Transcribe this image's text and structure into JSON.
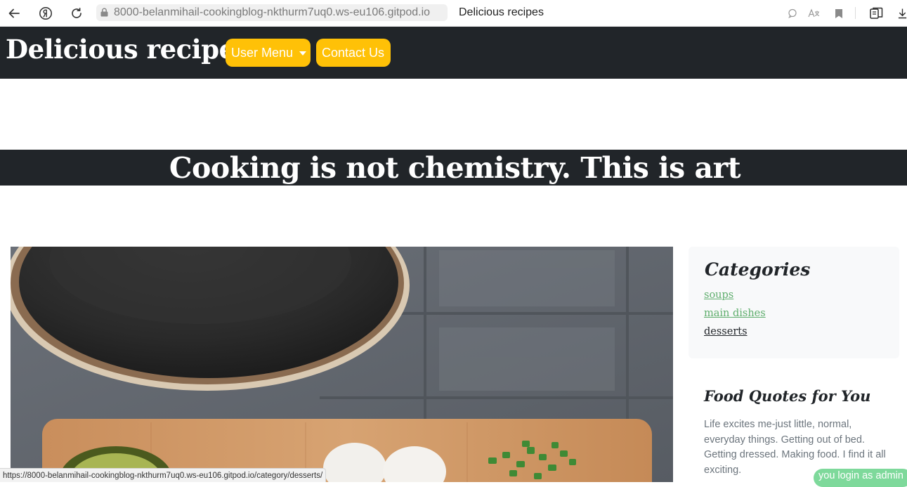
{
  "browser": {
    "url": "8000-belanmihail-cookingblog-nkthurm7uq0.ws-eu106.gitpod.io",
    "tab_title": "Delicious recipes",
    "icons": [
      "back-icon",
      "yandex-icon",
      "reload-icon",
      "lock-icon",
      "chat-icon",
      "translate-icon",
      "bookmark-icon",
      "collections-icon",
      "download-icon"
    ]
  },
  "header": {
    "brand": "Delicious recipes",
    "user_menu_label": "User Menu",
    "contact_label": "Contact Us",
    "accent_color": "#ffc107",
    "background_color": "#212529"
  },
  "hero": {
    "title": "Cooking is not chemistry. This is art"
  },
  "sidebar": {
    "categories_heading": "Categories",
    "categories": [
      {
        "label": "soups",
        "color": "#5fae6d"
      },
      {
        "label": "main dishes",
        "color": "#5fae6d"
      },
      {
        "label": "desserts",
        "color": "#212529"
      }
    ],
    "quotes_heading": "Food Quotes for You",
    "quote": "Life excites me-just little, normal, everyday things. Getting out of bed. Getting dressed. Making food. I find it all exciting."
  },
  "status_bar": {
    "hover_url": "https://8000-belanmihail-cookingblog-nkthurm7uq0.ws-eu106.gitpod.io/category/desserts/"
  },
  "toast": {
    "message": "you login as admin",
    "color": "#7ed99b"
  }
}
